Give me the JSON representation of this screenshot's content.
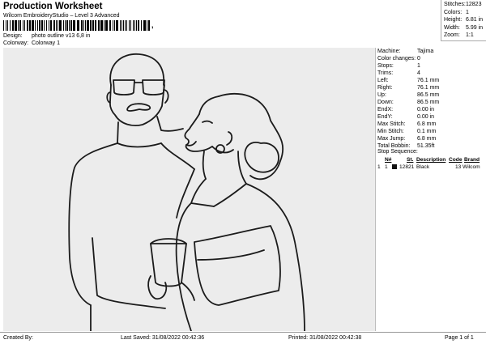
{
  "header": {
    "title": "Production Worksheet",
    "subtitle": "Wilcom EmbroideryStudio – Level 3 Advanced",
    "barcode_suffix": ",",
    "design_label": "Design:",
    "design_value": "photo outline v13 6,8 in",
    "colorway_label": "Colorway:",
    "colorway_value": "Colorway 1"
  },
  "summary": [
    {
      "label": "Stitches:",
      "value": "12823"
    },
    {
      "label": "Colors:",
      "value": "1"
    },
    {
      "label": "Height:",
      "value": "6.81 in"
    },
    {
      "label": "Width:",
      "value": "5.99 in"
    },
    {
      "label": "Zoom:",
      "value": "1:1"
    }
  ],
  "details": [
    {
      "label": "Machine:",
      "value": "Tajima"
    },
    {
      "label": "Color changes:",
      "value": "0"
    },
    {
      "label": "Stops:",
      "value": "1"
    },
    {
      "label": "Trims:",
      "value": "4"
    },
    {
      "label": "Left:",
      "value": "76.1 mm"
    },
    {
      "label": "Right:",
      "value": "76.1 mm"
    },
    {
      "label": "Up:",
      "value": "86.5 mm"
    },
    {
      "label": "Down:",
      "value": "86.5 mm"
    },
    {
      "label": "EndX:",
      "value": "0.00 in"
    },
    {
      "label": "EndY:",
      "value": "0.00 in"
    },
    {
      "label": "Max Stitch:",
      "value": "6.8 mm"
    },
    {
      "label": "Min Stitch:",
      "value": "0.1 mm"
    },
    {
      "label": "Max Jump:",
      "value": "6.8 mm"
    },
    {
      "label": "Total Bobbin:",
      "value": "51.35ft"
    }
  ],
  "stop_sequence": {
    "title": "Stop Sequence:",
    "columns": [
      "N#",
      "St.",
      "Description",
      "Code",
      "Brand"
    ],
    "rows": [
      {
        "index": "1",
        "n": "1",
        "swatch_color": "#111111",
        "stitches": "12821",
        "description": "Black",
        "code": "13",
        "brand": "Wilcom"
      }
    ]
  },
  "footer": {
    "created_by": "Created By:",
    "last_saved": "Last Saved: 31/08/2022 00:42:36",
    "printed": "Printed: 31/08/2022 00:42:38",
    "page": "Page 1 of 1"
  },
  "colors": {
    "canvas_bg": "#ececec",
    "thread": "#1b1b1b"
  }
}
